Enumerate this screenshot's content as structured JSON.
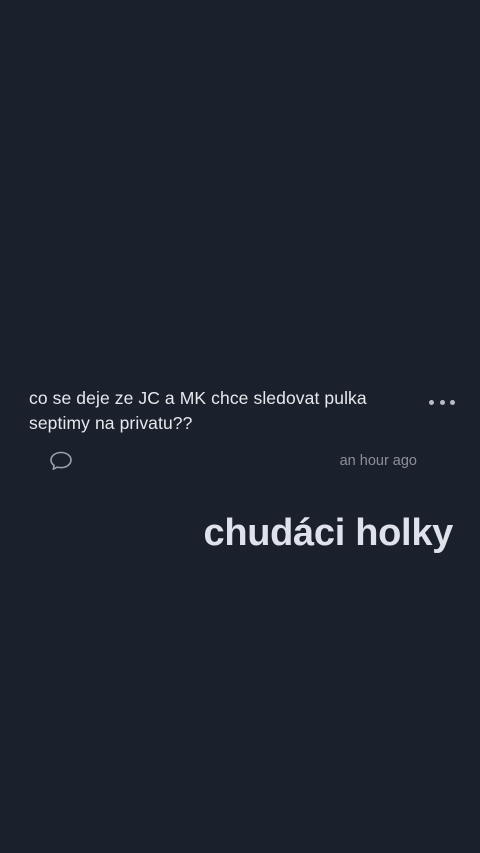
{
  "post": {
    "text": "co se deje ze JC a MK chce sledovat pulka septimy na privatu??",
    "timestamp": "an hour ago",
    "comment_icon": "speech-bubble-icon",
    "more_icon": "more-horizontal-icon"
  },
  "overlay": {
    "caption": "chudáci holky"
  },
  "colors": {
    "background": "#1b202d",
    "text": "#e6e8ec",
    "muted": "#8a8f9b",
    "overlay_text": "#dfe2ea"
  }
}
